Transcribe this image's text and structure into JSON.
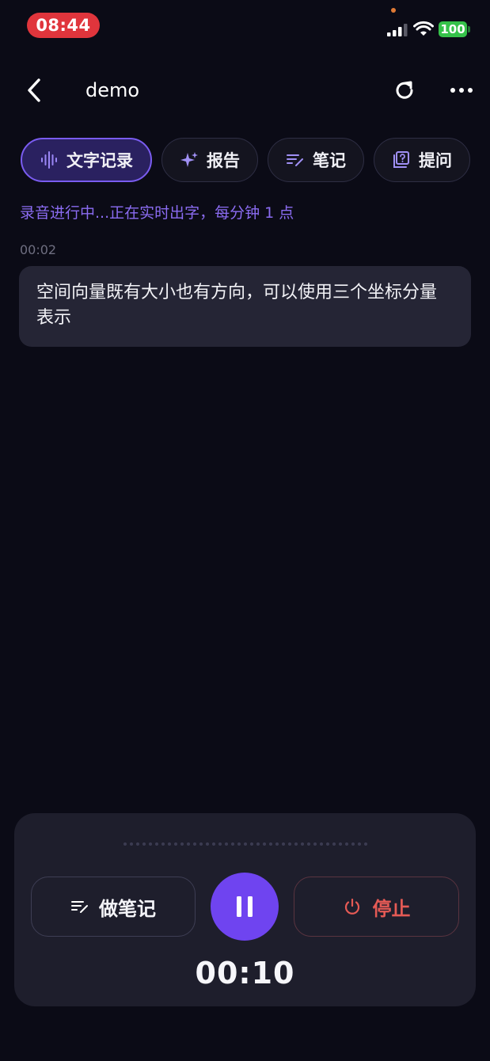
{
  "status_bar": {
    "time": "08:44",
    "battery": "100",
    "battery_color": "#36c24a",
    "time_pill_color": "#e0353c"
  },
  "nav": {
    "title": "demo",
    "back_icon": "chevron-left-icon",
    "refresh_icon": "refresh-icon",
    "more_icon": "more-horizontal-icon"
  },
  "tabs": [
    {
      "label": "文字记录",
      "icon": "waveform-icon",
      "active": true
    },
    {
      "label": "报告",
      "icon": "sparkle-icon",
      "active": false
    },
    {
      "label": "笔记",
      "icon": "note-pen-icon",
      "active": false
    },
    {
      "label": "提问",
      "icon": "question-card-icon",
      "active": false
    }
  ],
  "live_status": "录音进行中...正在实时出字，每分钟 1 点",
  "transcript": [
    {
      "time": "00:02",
      "text": "空间向量既有大小也有方向，可以使用三个坐标分量表示"
    }
  ],
  "controls": {
    "note_label": "做笔记",
    "stop_label": "停止",
    "timer": "00:10",
    "accent_color": "#6f44f0",
    "stop_color": "#e55a55"
  }
}
